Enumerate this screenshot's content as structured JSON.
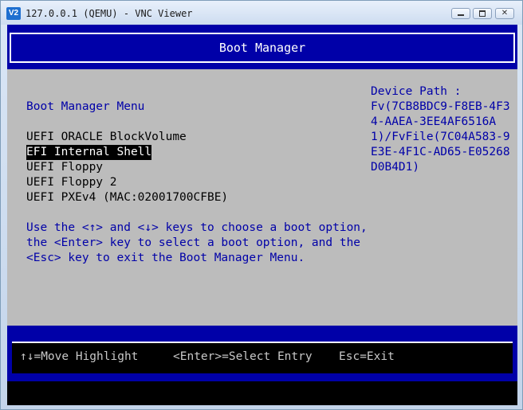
{
  "window": {
    "title": "127.0.0.1 (QEMU) - VNC Viewer",
    "app_icon_text": "V2",
    "close_glyph": "✕"
  },
  "boot_manager": {
    "title": "Boot Manager",
    "menu_heading": "Boot Manager Menu",
    "entries": [
      "UEFI ORACLE BlockVolume",
      "EFI Internal Shell",
      "UEFI Floppy",
      "UEFI Floppy 2",
      "UEFI PXEv4 (MAC:02001700CFBE)"
    ],
    "selected_index": 1,
    "help_text": "Use the <↑> and <↓> keys to choose a boot option,\nthe <Enter> key to select a boot option, and the\n<Esc> key to exit the Boot Manager Menu.",
    "device_path_label": "Device Path :",
    "device_path_value": "Fv(7CB8BDC9-F8EB-4F34-AAEA-3EE4AF6516A1)/FvFile(7C04A583-9E3E-4F1C-AD65-E05268D0B4D1)"
  },
  "footer": {
    "move": "↑↓=Move Highlight",
    "select": "<Enter>=Select Entry",
    "exit": "Esc=Exit"
  },
  "colors": {
    "bios_blue": "#0000a8",
    "bios_gray": "#bcbcbc",
    "highlight_bg": "#000000",
    "highlight_fg": "#ffffff"
  }
}
